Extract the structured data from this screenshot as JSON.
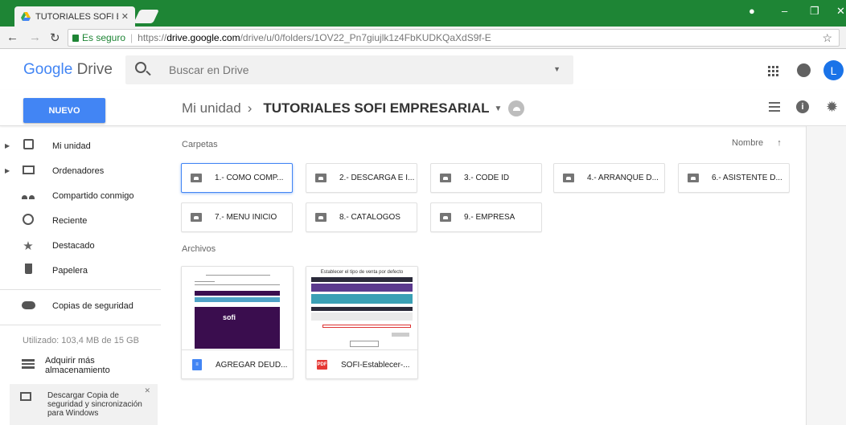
{
  "browser": {
    "tab_title": "TUTORIALES SOFI EMPRE",
    "secure_label": "Es seguro",
    "url_scheme": "https://",
    "url_host": "drive.google.com",
    "url_path": "/drive/u/0/folders/1OV22_Pn7giujlk1z4FbKUDKQaXdS9f-E"
  },
  "header": {
    "logo_google": "Google",
    "logo_drive": "Drive",
    "search_placeholder": "Buscar en Drive",
    "avatar_letter": "L"
  },
  "toolbar": {
    "new_button": "NUEVO",
    "breadcrumb_root": "Mi unidad",
    "breadcrumb_current": "TUTORIALES SOFI EMPRESARIAL"
  },
  "sidebar": {
    "items": [
      {
        "label": "Mi unidad",
        "icon": "drive-icon"
      },
      {
        "label": "Ordenadores",
        "icon": "computer-icon"
      },
      {
        "label": "Compartido conmigo",
        "icon": "people-icon"
      },
      {
        "label": "Reciente",
        "icon": "clock-icon"
      },
      {
        "label": "Destacado",
        "icon": "star-icon"
      },
      {
        "label": "Papelera",
        "icon": "trash-icon"
      },
      {
        "label": "Copias de seguridad",
        "icon": "cloud-icon"
      }
    ],
    "usage": "Utilizado: 103,4 MB de 15 GB",
    "more_storage": "Adquirir más almacenamiento",
    "backup_banner": "Descargar Copia de seguridad y sincronización para Windows"
  },
  "main": {
    "folders_title": "Carpetas",
    "sort_label": "Nombre",
    "folders": [
      "1.- COMO COMP...",
      "2.- DESCARGA E I...",
      "3.- CODE ID",
      "4.- ARRANQUE D...",
      "6.- ASISTENTE D...",
      "7.- MENU INICIO",
      "8.- CATÁLOGOS",
      "9.- EMPRESA"
    ],
    "files_title": "Archivos",
    "files": [
      {
        "name": "AGREGAR DEUD...",
        "type": "doc"
      },
      {
        "name": "SOFI-Establecer-...",
        "type": "pdf"
      }
    ],
    "pdf_preview_title": "Establecer el tipo de venta por defecto",
    "doc_preview_brand": "sofi"
  },
  "colors": {
    "titlebar": "#1e8535",
    "accent": "#4285f4",
    "doc_preview": "#3a0d4e"
  }
}
